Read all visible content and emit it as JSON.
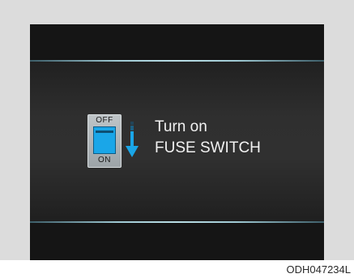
{
  "display": {
    "switch": {
      "off_label": "OFF",
      "on_label": "ON",
      "paddle_color": "#1aa6e8",
      "icon": "fuse-switch-icon"
    },
    "arrow": {
      "icon": "arrow-down-icon",
      "color": "#1aa6e8"
    },
    "message": {
      "line1": "Turn on",
      "line2": "FUSE SWITCH"
    },
    "accent_line_color": "#9fc9d3"
  },
  "caption": "ODH047234L"
}
